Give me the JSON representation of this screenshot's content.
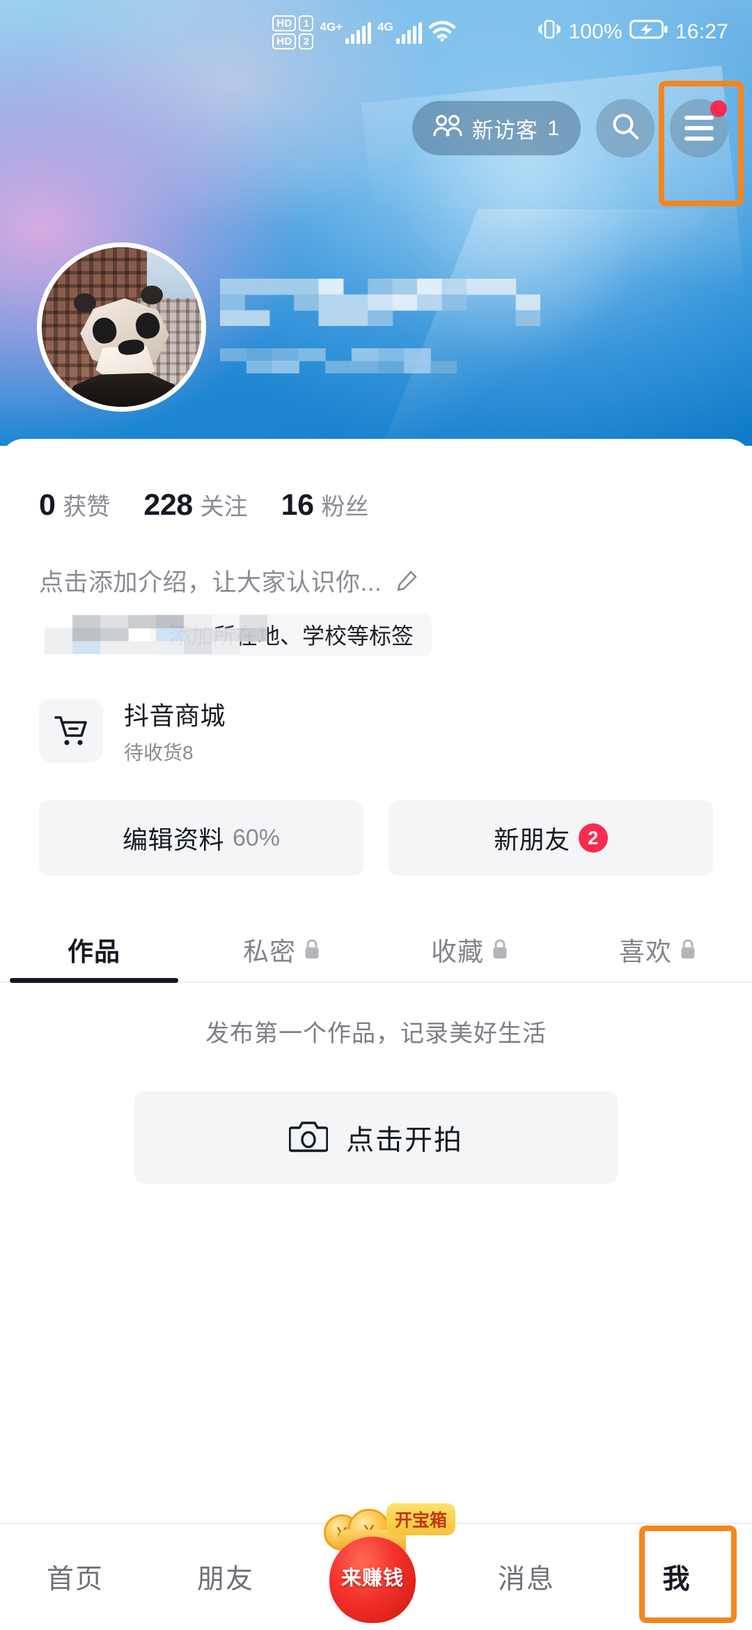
{
  "status_bar": {
    "hd1_label": "HD",
    "hd1_num": "1",
    "hd2_label": "HD",
    "hd2_num": "2",
    "sim1_net": "4G+",
    "sim2_net": "4G",
    "wifi_icon": "wifi-icon",
    "vibrate_icon": "vibrate-icon",
    "battery_percent": "100%",
    "battery_icon": "battery-charging-icon",
    "time": "16:27"
  },
  "top_nav": {
    "visitor_icon": "visitors-icon",
    "visitor_label": "新访客",
    "visitor_count": "1",
    "search_icon": "search-icon",
    "menu_icon": "hamburger-menu-icon",
    "menu_has_badge": true
  },
  "profile": {
    "avatar_name": "panda-avatar",
    "username_redacted": true,
    "userid_redacted": true
  },
  "stats": [
    {
      "num": "0",
      "label": "获赞"
    },
    {
      "num": "228",
      "label": "关注"
    },
    {
      "num": "16",
      "label": "粉丝"
    }
  ],
  "bio": {
    "placeholder": "点击添加介绍，让大家认识你...",
    "edit_icon": "pencil-edit-icon"
  },
  "tags": {
    "add_tag_label": "添加所在地、学校等标签",
    "redacted_tag": true
  },
  "mall": {
    "icon": "shopping-cart-icon",
    "title": "抖音商城",
    "subtitle": "待收货8"
  },
  "actions": [
    {
      "label": "编辑资料",
      "suffix": "60%",
      "badge": ""
    },
    {
      "label": "新朋友",
      "suffix": "",
      "badge": "2"
    }
  ],
  "tabs": [
    {
      "label": "作品",
      "locked": false,
      "active": true
    },
    {
      "label": "私密",
      "locked": true,
      "active": false
    },
    {
      "label": "收藏",
      "locked": true,
      "active": false
    },
    {
      "label": "喜欢",
      "locked": true,
      "active": false
    }
  ],
  "empty_state": {
    "message": "发布第一个作品，记录美好生活",
    "button_label": "点击开拍",
    "button_icon": "camera-icon"
  },
  "bottom_nav": [
    {
      "label": "首页",
      "active": false
    },
    {
      "label": "朋友",
      "active": false
    },
    {
      "label": "来赚钱",
      "active": false,
      "tag": "开宝箱"
    },
    {
      "label": "消息",
      "active": false
    },
    {
      "label": "我",
      "active": true
    }
  ],
  "highlights": {
    "color": "#f5851f",
    "targets": [
      "hamburger-menu-icon",
      "bottom-nav-me"
    ]
  }
}
